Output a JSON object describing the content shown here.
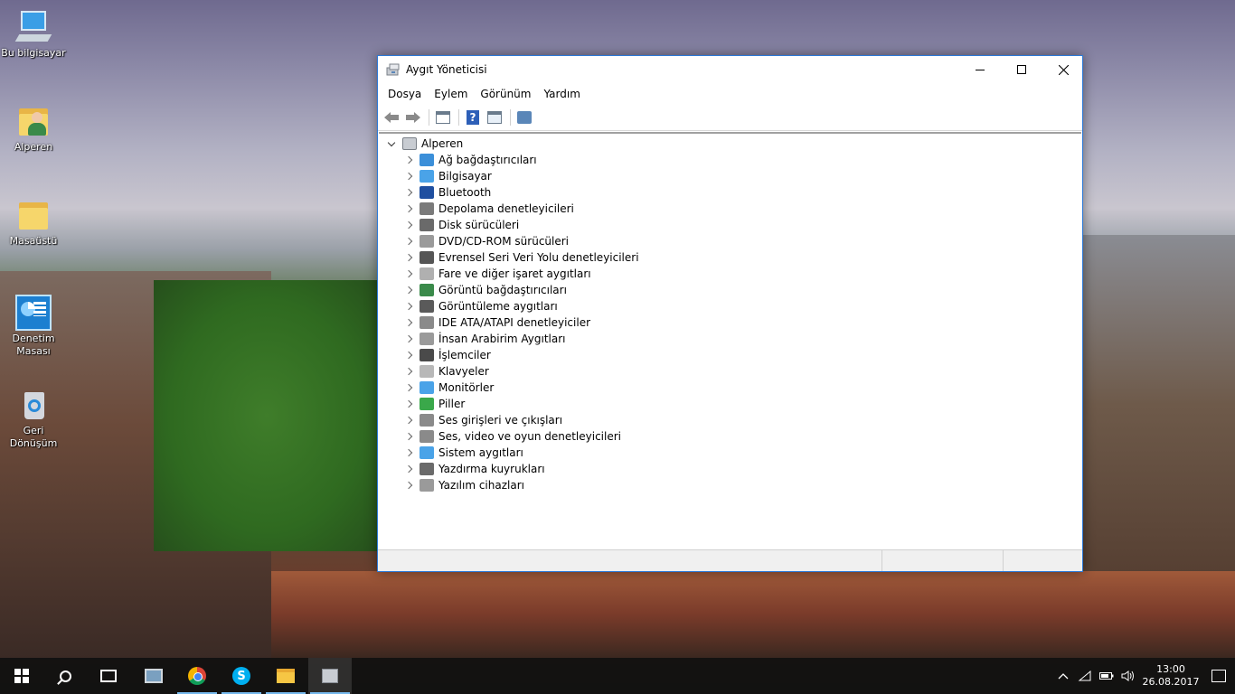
{
  "desktop": {
    "icons": [
      {
        "label": "Bu bilgisayar",
        "icon": "computer-icon"
      },
      {
        "label": "Alperen",
        "icon": "user-folder-icon"
      },
      {
        "label": "Masaüstü",
        "icon": "folder-icon"
      },
      {
        "label": "Denetim Masası",
        "icon": "control-panel-icon"
      },
      {
        "label": "Geri Dönüşüm",
        "icon": "recycle-bin-icon"
      }
    ]
  },
  "window": {
    "title": "Aygıt Yöneticisi",
    "menu": [
      "Dosya",
      "Eylem",
      "Görünüm",
      "Yardım"
    ],
    "tree": {
      "root": "Alperen",
      "items": [
        {
          "label": "Ağ bağdaştırıcıları",
          "color": "#3b8fd9"
        },
        {
          "label": "Bilgisayar",
          "color": "#4aa3e8"
        },
        {
          "label": "Bluetooth",
          "color": "#1f4fa0"
        },
        {
          "label": "Depolama denetleyicileri",
          "color": "#7a7a7a"
        },
        {
          "label": "Disk sürücüleri",
          "color": "#6a6a6a"
        },
        {
          "label": "DVD/CD-ROM sürücüleri",
          "color": "#9a9a9a"
        },
        {
          "label": "Evrensel Seri Veri Yolu denetleyicileri",
          "color": "#555555"
        },
        {
          "label": "Fare ve diğer işaret aygıtları",
          "color": "#b0b0b0"
        },
        {
          "label": "Görüntü bağdaştırıcıları",
          "color": "#3a8a4a"
        },
        {
          "label": "Görüntüleme aygıtları",
          "color": "#5a5a5a"
        },
        {
          "label": "IDE ATA/ATAPI denetleyiciler",
          "color": "#8a8a8a"
        },
        {
          "label": "İnsan Arabirim Aygıtları",
          "color": "#9a9a9a"
        },
        {
          "label": "İşlemciler",
          "color": "#4a4a4a"
        },
        {
          "label": "Klavyeler",
          "color": "#b8b8b8"
        },
        {
          "label": "Monitörler",
          "color": "#4aa3e8"
        },
        {
          "label": "Piller",
          "color": "#3aa84a"
        },
        {
          "label": "Ses girişleri ve çıkışları",
          "color": "#8a8a8a"
        },
        {
          "label": "Ses, video ve oyun denetleyicileri",
          "color": "#8a8a8a"
        },
        {
          "label": "Sistem aygıtları",
          "color": "#4aa3e8"
        },
        {
          "label": "Yazdırma kuyrukları",
          "color": "#6a6a6a"
        },
        {
          "label": "Yazılım cihazları",
          "color": "#9a9a9a"
        }
      ]
    }
  },
  "taskbar": {
    "apps": [
      "start",
      "search",
      "task-view",
      "monitor",
      "chrome",
      "skype",
      "file-explorer",
      "device-manager"
    ],
    "clock": {
      "time": "13:00",
      "date": "26.08.2017"
    },
    "accent": "#76b9ed"
  }
}
